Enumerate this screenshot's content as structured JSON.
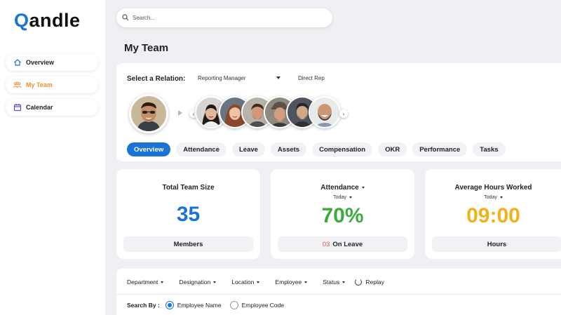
{
  "app": {
    "logo_text": "andle",
    "logo_q": "Q"
  },
  "sidebar": {
    "items": [
      {
        "label": "Overview",
        "icon": "home-icon"
      },
      {
        "label": "My Team",
        "icon": "team-icon"
      },
      {
        "label": "Calendar",
        "icon": "calendar-icon"
      }
    ],
    "active_index": 1
  },
  "search": {
    "placeholder": "Search..."
  },
  "page": {
    "title": "My Team"
  },
  "relation": {
    "label": "Select a Relation:",
    "selected": "Reporting Manager",
    "secondary": "Direct Rep"
  },
  "tabs": [
    "Overview",
    "Attendance",
    "Leave",
    "Assets",
    "Compensation",
    "OKR",
    "Performance",
    "Tasks"
  ],
  "cards": {
    "team_size": {
      "title": "Total Team Size",
      "value": "35",
      "footer": "Members",
      "color": "#1a73d9"
    },
    "attendance": {
      "title": "Attendance",
      "sub": "Today",
      "value": "70%",
      "footer_count": "03",
      "footer_text": "On Leave",
      "color": "#3cab3c"
    },
    "hours": {
      "title": "Average Hours Worked",
      "sub": "Today",
      "value": "09:00",
      "footer": "Hours",
      "color": "#f0b21b"
    }
  },
  "filters": {
    "items": [
      "Department",
      "Designation",
      "Location",
      "Employee",
      "Status"
    ],
    "replay": "Replay",
    "search_by_label": "Search By :",
    "options": [
      "Employee Name",
      "Employee Code"
    ],
    "selected_option": 0
  },
  "colors": {
    "accent": "#1a73d9",
    "active_nav": "#e8912d",
    "leave_count": "#e05555"
  }
}
